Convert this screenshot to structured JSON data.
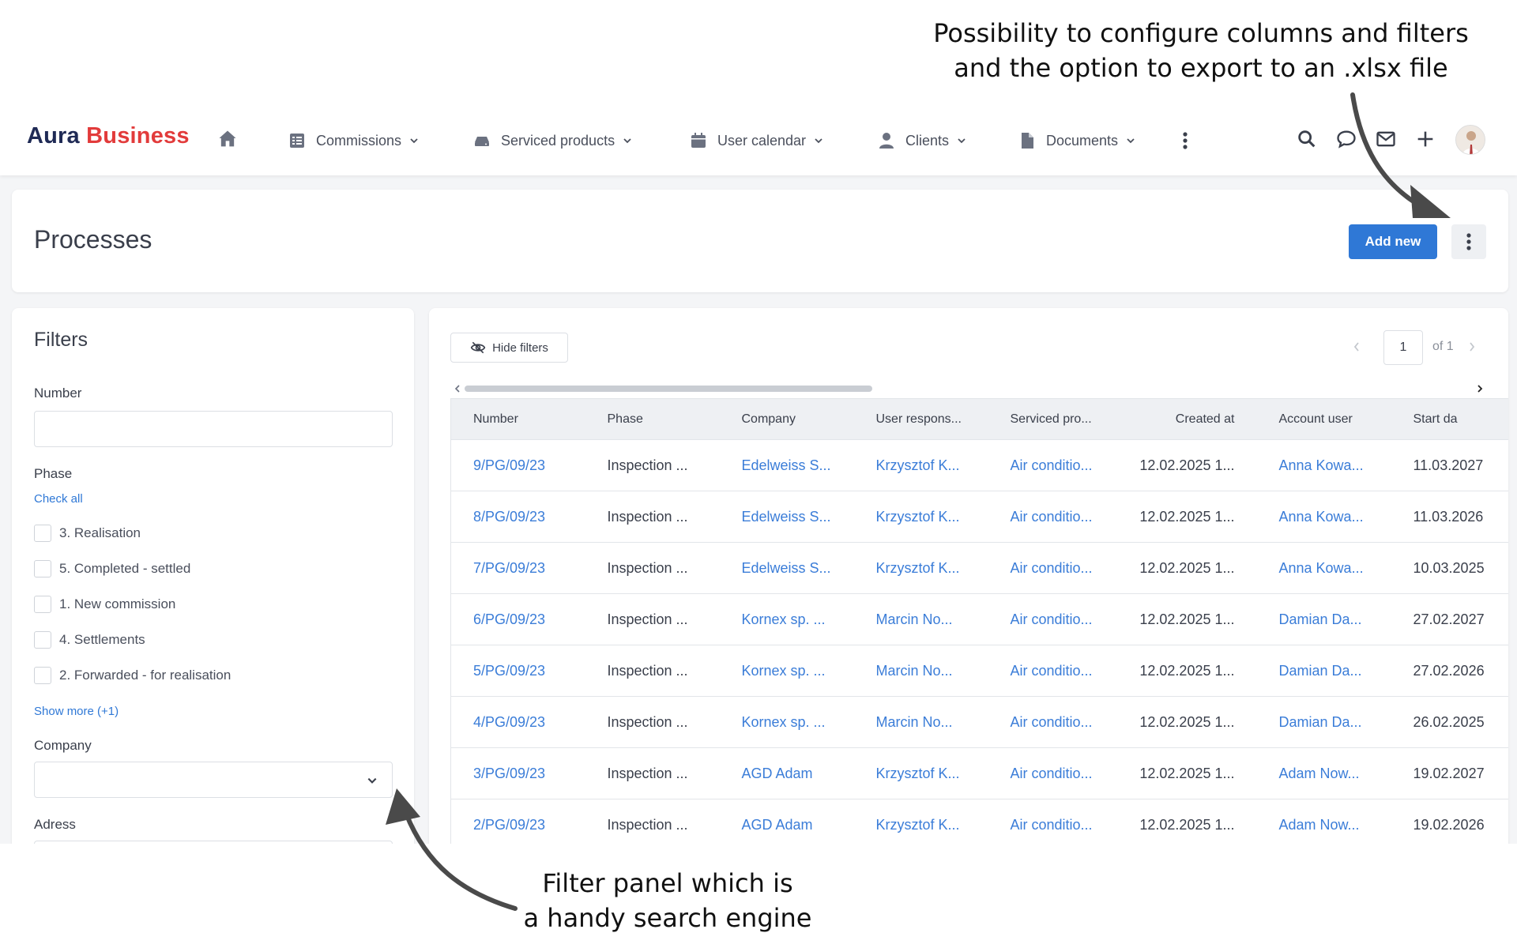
{
  "annotations": {
    "top_line1": "Possibility to configure columns and filters",
    "top_line2": "and the option to export to an .xlsx file",
    "bottom_line1": "Filter panel which is",
    "bottom_line2": "a handy search engine"
  },
  "brand": {
    "part1": "Aura",
    "part2": "Business",
    "color_dark": "#1f2a55",
    "color_red": "#e23b3b"
  },
  "nav": {
    "home_icon": "home-icon",
    "items": [
      {
        "label": "Commissions",
        "icon": "list-icon"
      },
      {
        "label": "Serviced products",
        "icon": "drive-icon"
      },
      {
        "label": "User calendar",
        "icon": "calendar-icon"
      },
      {
        "label": "Clients",
        "icon": "user-icon"
      },
      {
        "label": "Documents",
        "icon": "document-icon"
      }
    ],
    "right_icons": [
      "search-icon",
      "chat-icon",
      "mail-icon",
      "plus-icon",
      "avatar"
    ]
  },
  "header": {
    "title": "Processes",
    "add_button": "Add new",
    "accent": "#2f78d6"
  },
  "filters": {
    "title": "Filters",
    "number_label": "Number",
    "number_value": "",
    "phase_label": "Phase",
    "check_all": "Check all",
    "phases": [
      "3. Realisation",
      "5. Completed - settled",
      "1. New commission",
      "4. Settlements",
      "2. Forwarded - for realisation"
    ],
    "show_more": "Show more (+1)",
    "company_label": "Company",
    "company_value": "",
    "address_label": "Adress"
  },
  "table": {
    "hide_filters": "Hide filters",
    "page": "1",
    "of_pages": "of 1",
    "columns": [
      "Number",
      "Phase",
      "Company",
      "User respons...",
      "Serviced pro...",
      "Created at",
      "Account user",
      "Start da"
    ],
    "rows": [
      [
        "9/PG/09/23",
        "Inspection ...",
        "Edelweiss S...",
        "Krzysztof K...",
        "Air conditio...",
        "12.02.2025 1...",
        "Anna Kowa...",
        "11.03.2027"
      ],
      [
        "8/PG/09/23",
        "Inspection ...",
        "Edelweiss S...",
        "Krzysztof K...",
        "Air conditio...",
        "12.02.2025 1...",
        "Anna Kowa...",
        "11.03.2026"
      ],
      [
        "7/PG/09/23",
        "Inspection ...",
        "Edelweiss S...",
        "Krzysztof K...",
        "Air conditio...",
        "12.02.2025 1...",
        "Anna Kowa...",
        "10.03.2025"
      ],
      [
        "6/PG/09/23",
        "Inspection ...",
        "Kornex sp. ...",
        "Marcin No...",
        "Air conditio...",
        "12.02.2025 1...",
        "Damian Da...",
        "27.02.2027"
      ],
      [
        "5/PG/09/23",
        "Inspection ...",
        "Kornex sp. ...",
        "Marcin No...",
        "Air conditio...",
        "12.02.2025 1...",
        "Damian Da...",
        "27.02.2026"
      ],
      [
        "4/PG/09/23",
        "Inspection ...",
        "Kornex sp. ...",
        "Marcin No...",
        "Air conditio...",
        "12.02.2025 1...",
        "Damian Da...",
        "26.02.2025"
      ],
      [
        "3/PG/09/23",
        "Inspection ...",
        "AGD Adam",
        "Krzysztof K...",
        "Air conditio...",
        "12.02.2025 1...",
        "Adam Now...",
        "19.02.2027"
      ],
      [
        "2/PG/09/23",
        "Inspection ...",
        "AGD Adam",
        "Krzysztof K...",
        "Air conditio...",
        "12.02.2025 1...",
        "Adam Now...",
        "19.02.2026"
      ]
    ],
    "link_color": "#3b7dd8"
  }
}
